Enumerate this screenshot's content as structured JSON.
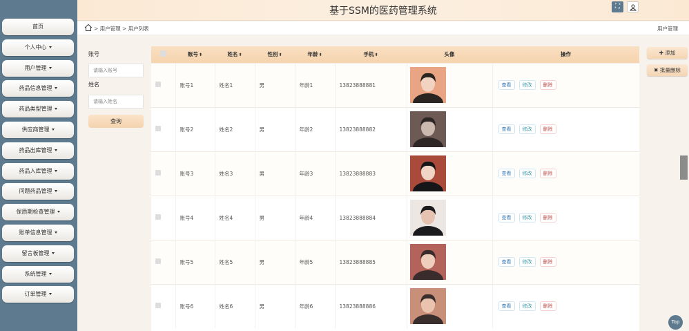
{
  "app": {
    "title": "基于SSM的医药管理系统"
  },
  "colors": {
    "sidebar": "#5d7a8f",
    "header": "#fbe9d4",
    "accent": "#f6d4ae"
  },
  "sidebar": {
    "items": [
      {
        "label": "首页",
        "has_caret": false
      },
      {
        "label": "个人中心",
        "has_caret": true
      },
      {
        "label": "用户管理",
        "has_caret": true
      },
      {
        "label": "药品信息管理",
        "has_caret": true
      },
      {
        "label": "药品类型管理",
        "has_caret": true
      },
      {
        "label": "供应商管理",
        "has_caret": true
      },
      {
        "label": "药品出库管理",
        "has_caret": true
      },
      {
        "label": "药品入库管理",
        "has_caret": true
      },
      {
        "label": "问题药品管理",
        "has_caret": true
      },
      {
        "label": "保质期检查管理",
        "has_caret": true
      },
      {
        "label": "账单信息管理",
        "has_caret": true
      },
      {
        "label": "留言板管理",
        "has_caret": true
      },
      {
        "label": "系统管理",
        "has_caret": true
      },
      {
        "label": "订单管理",
        "has_caret": true
      }
    ]
  },
  "header": {
    "fullscreen_icon": "fullscreen-icon",
    "user_icon": "user-icon"
  },
  "breadcrumb": {
    "home_icon": "home-icon",
    "path": "> 用户管理 > 用户列表",
    "right": "用户管理"
  },
  "search": {
    "account_label": "账号",
    "account_placeholder": "请输入账号",
    "name_label": "姓名",
    "name_placeholder": "请输入姓名",
    "query_label": "查询"
  },
  "actions": {
    "add_label": "添加",
    "batch_delete_label": "批量删除"
  },
  "table": {
    "columns": [
      "账号",
      "姓名",
      "性别",
      "年龄",
      "手机",
      "头像",
      "操作"
    ],
    "row_actions": {
      "view": "查看",
      "edit": "修改",
      "delete": "删除"
    },
    "rows": [
      {
        "account": "账号1",
        "name": "姓名1",
        "gender": "男",
        "age": "年龄1",
        "phone": "13823888881"
      },
      {
        "account": "账号2",
        "name": "姓名2",
        "gender": "男",
        "age": "年龄2",
        "phone": "13823888882"
      },
      {
        "account": "账号3",
        "name": "姓名3",
        "gender": "男",
        "age": "年龄3",
        "phone": "13823888883"
      },
      {
        "account": "账号4",
        "name": "姓名4",
        "gender": "男",
        "age": "年龄4",
        "phone": "13823888884"
      },
      {
        "account": "账号5",
        "name": "姓名5",
        "gender": "男",
        "age": "年龄5",
        "phone": "13823888885"
      },
      {
        "account": "账号6",
        "name": "姓名6",
        "gender": "男",
        "age": "年龄6",
        "phone": "13823888886"
      }
    ]
  },
  "top_button": "Top"
}
